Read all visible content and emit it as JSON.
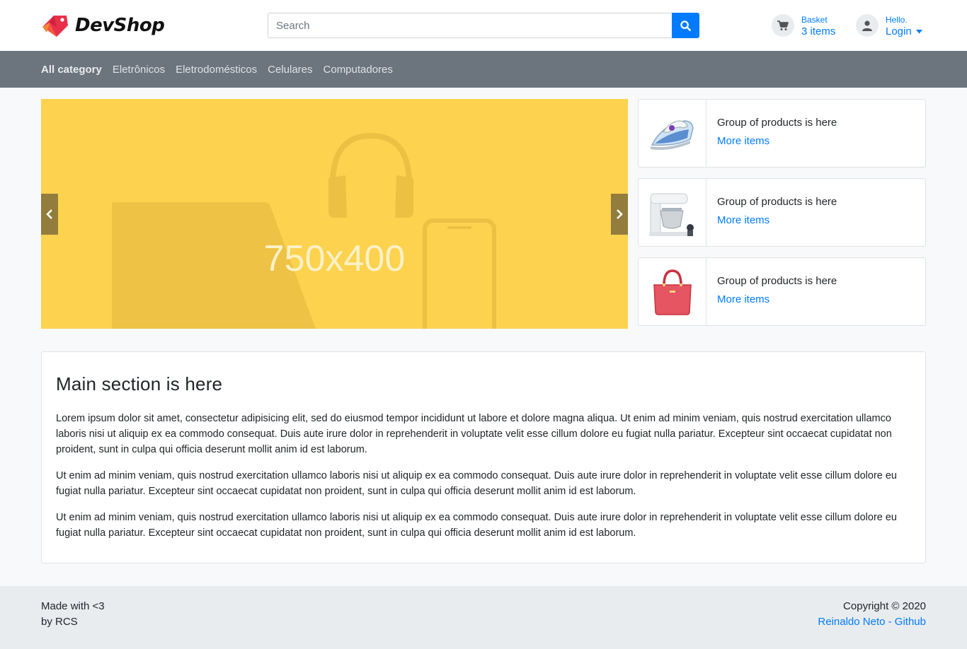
{
  "brand": {
    "name": "DevShop"
  },
  "search": {
    "placeholder": "Search"
  },
  "basket": {
    "label": "Basket",
    "count": "3 items"
  },
  "account": {
    "greeting": "Hello.",
    "login": "Login"
  },
  "categories": [
    {
      "label": "All category",
      "active": true
    },
    {
      "label": "Eletrônicos"
    },
    {
      "label": "Eletrodomésticos"
    },
    {
      "label": "Celulares"
    },
    {
      "label": "Computadores"
    }
  ],
  "slider": {
    "label": "750x400"
  },
  "groups": [
    {
      "title": "Group of products is here",
      "link": "More items",
      "icon": "iron-icon"
    },
    {
      "title": "Group of products is here",
      "link": "More items",
      "icon": "mixer-icon"
    },
    {
      "title": "Group of products is here",
      "link": "More items",
      "icon": "handbag-icon"
    }
  ],
  "main": {
    "heading": "Main section is here",
    "paragraphs": [
      "Lorem ipsum dolor sit amet, consectetur adipisicing elit, sed do eiusmod tempor incididunt ut labore et dolore magna aliqua. Ut enim ad minim veniam, quis nostrud exercitation ullamco laboris nisi ut aliquip ex ea commodo consequat. Duis aute irure dolor in reprehenderit in voluptate velit esse cillum dolore eu fugiat nulla pariatur. Excepteur sint occaecat cupidatat non proident, sunt in culpa qui officia deserunt mollit anim id est laborum.",
      "Ut enim ad minim veniam, quis nostrud exercitation ullamco laboris nisi ut aliquip ex ea commodo consequat. Duis aute irure dolor in reprehenderit in voluptate velit esse cillum dolore eu fugiat nulla pariatur. Excepteur sint occaecat cupidatat non proident, sunt in culpa qui officia deserunt mollit anim id est laborum.",
      "Ut enim ad minim veniam, quis nostrud exercitation ullamco laboris nisi ut aliquip ex ea commodo consequat. Duis aute irure dolor in reprehenderit in voluptate velit esse cillum dolore eu fugiat nulla pariatur. Excepteur sint occaecat cupidatat non proident, sunt in culpa qui officia deserunt mollit anim id est laborum."
    ]
  },
  "footer": {
    "made_with": "Made with <3",
    "by": "by RCS",
    "copyright": "Copyright © 2020",
    "github_link": "Reinaldo Neto - Github"
  },
  "colors": {
    "primary": "#007bff",
    "nav": "#6c757d",
    "slider": "#fdd24f",
    "footer": "#e9ecef"
  }
}
